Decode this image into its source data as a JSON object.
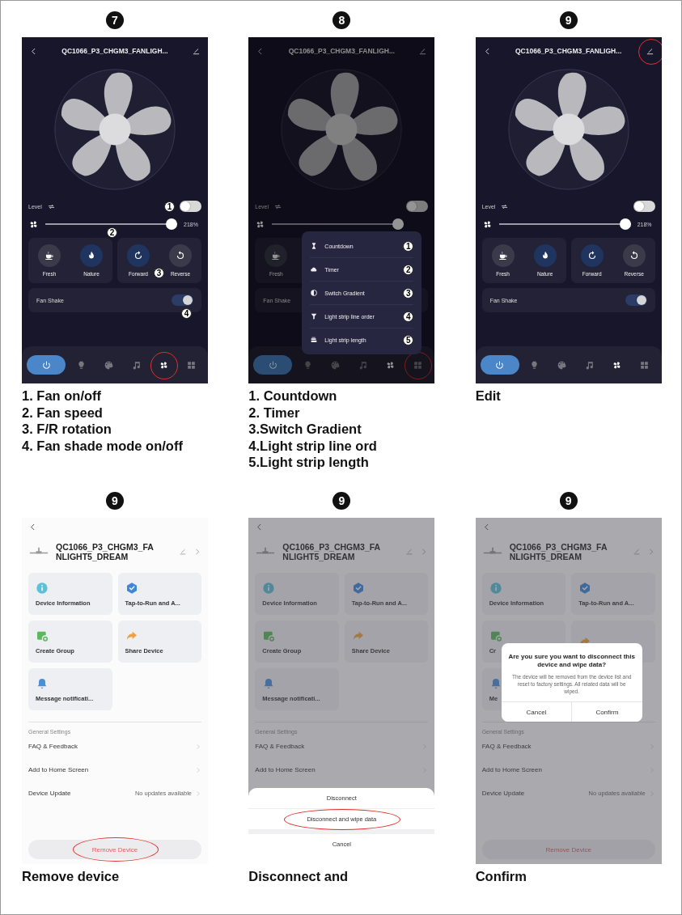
{
  "panels": [
    {
      "step": "7",
      "screen": {
        "kind": "control",
        "title": "QC1066_P3_CHGM3_FANLIGH...",
        "edit_circled": false,
        "level_label": "Level",
        "light_on": false,
        "light_callout": "1",
        "speed": {
          "level": 1,
          "reading": "218%",
          "callout": "2"
        },
        "modes": [
          {
            "kind": "fresh",
            "label": "Fresh",
            "selected": false
          },
          {
            "kind": "nature",
            "label": "Nature",
            "selected": true
          }
        ],
        "directions": [
          {
            "kind": "forward",
            "label": "Forward",
            "selected": true
          },
          {
            "kind": "reverse",
            "label": "Reverse",
            "selected": false
          }
        ],
        "direction_callout": "3",
        "shake": {
          "label": "Fan Shake",
          "on": true,
          "callout": "4"
        },
        "power_on": true,
        "tabs": [
          {
            "kind": "bulb",
            "selected": false,
            "circled": false
          },
          {
            "kind": "palette",
            "selected": false,
            "circled": false
          },
          {
            "kind": "music",
            "selected": false,
            "circled": false
          },
          {
            "kind": "fan",
            "selected": true,
            "circled": true
          },
          {
            "kind": "grid",
            "selected": false,
            "circled": false
          }
        ]
      },
      "caption": [
        "1. Fan on/off",
        "2. Fan speed",
        "3. F/R rotation",
        "4. Fan shade mode on/off"
      ]
    },
    {
      "step": "8",
      "screen": {
        "kind": "control",
        "dimmed": true,
        "title": "QC1066_P3_CHGM3_FANLIGH...",
        "edit_circled": false,
        "level_label": "Level",
        "light_on": false,
        "speed": {
          "level": 1
        },
        "modes": [
          {
            "kind": "fresh",
            "label": "Fresh",
            "selected": false
          }
        ],
        "shake": {
          "label": "Fan Shake"
        },
        "power_on": true,
        "tabs": [
          {
            "kind": "bulb",
            "selected": false,
            "circled": false
          },
          {
            "kind": "palette",
            "selected": false,
            "circled": false
          },
          {
            "kind": "music",
            "selected": false,
            "circled": false
          },
          {
            "kind": "fan",
            "selected": true,
            "circled": false
          },
          {
            "kind": "grid",
            "selected": false,
            "circled": true
          }
        ],
        "menu": [
          {
            "kind": "countdown",
            "label": "Countdown",
            "callout": "1"
          },
          {
            "kind": "timer",
            "label": "Timer",
            "callout": "2"
          },
          {
            "kind": "gradient",
            "label": "Switch Gradient",
            "callout": "3"
          },
          {
            "kind": "order",
            "label": "Light strip line order",
            "callout": "4"
          },
          {
            "kind": "length",
            "label": "Light strip length",
            "callout": "5"
          }
        ]
      },
      "caption": [
        "1. Countdown",
        "2. Timer",
        "3.Switch Gradient",
        "4.Light strip line ord",
        "5.Light strip length"
      ]
    },
    {
      "step": "9",
      "screen": {
        "kind": "control",
        "title": "QC1066_P3_CHGM3_FANLIGH...",
        "edit_circled": true,
        "level_label": "Level",
        "light_on": false,
        "speed": {
          "level": 1,
          "reading": "218%"
        },
        "modes": [
          {
            "kind": "fresh",
            "label": "Fresh",
            "selected": false
          },
          {
            "kind": "nature",
            "label": "Nature",
            "selected": true
          }
        ],
        "directions": [
          {
            "kind": "forward",
            "label": "Forward",
            "selected": true
          },
          {
            "kind": "reverse",
            "label": "Reverse",
            "selected": false
          }
        ],
        "shake": {
          "label": "Fan Shake",
          "on": true
        },
        "power_on": true,
        "tabs": [
          {
            "kind": "bulb",
            "selected": false,
            "circled": false
          },
          {
            "kind": "palette",
            "selected": false,
            "circled": false
          },
          {
            "kind": "music",
            "selected": false,
            "circled": false
          },
          {
            "kind": "fan",
            "selected": true,
            "circled": false
          },
          {
            "kind": "grid",
            "selected": false,
            "circled": false
          }
        ]
      },
      "caption": [
        "Edit"
      ]
    },
    {
      "step": "9",
      "screen": {
        "kind": "settings",
        "title_lines": [
          "QC1066_P3_CHGM3_FA",
          "NLIGHT5_DREAM"
        ],
        "tiles": [
          {
            "kind": "info",
            "label": "Device Information"
          },
          {
            "kind": "automation",
            "label": "Tap-to-Run and A..."
          },
          {
            "kind": "group",
            "label": "Create Group"
          },
          {
            "kind": "share",
            "label": "Share Device"
          },
          {
            "kind": "bell",
            "label": "Message notificati..."
          }
        ],
        "section": "General Settings",
        "rows": [
          {
            "label": "FAQ & Feedback"
          },
          {
            "label": "Add to Home Screen"
          },
          {
            "label": "Device Update",
            "value": "No updates available"
          }
        ],
        "remove": {
          "label": "Remove Device",
          "circled": true
        }
      },
      "caption": [
        "Remove device"
      ]
    },
    {
      "step": "9",
      "screen": {
        "kind": "settings",
        "dimmed": true,
        "title_lines": [
          "QC1066_P3_CHGM3_FA",
          "NLIGHT5_DREAM"
        ],
        "tiles": [
          {
            "kind": "info",
            "label": "Device Information"
          },
          {
            "kind": "automation",
            "label": "Tap-to-Run and A..."
          },
          {
            "kind": "group",
            "label": "Create Group"
          },
          {
            "kind": "share",
            "label": "Share Device"
          },
          {
            "kind": "bell",
            "label": "Message notificati..."
          }
        ],
        "section": "General Settings",
        "rows": [
          {
            "label": "FAQ & Feedback"
          },
          {
            "label": "Add to Home Screen"
          }
        ],
        "sheet": {
          "options": [
            {
              "label": "Disconnect",
              "circled": false
            },
            {
              "label": "Disconnect and wipe data",
              "circled": true
            }
          ],
          "cancel": "Cancel"
        }
      },
      "caption": [
        "Disconnect and"
      ]
    },
    {
      "step": "9",
      "screen": {
        "kind": "settings",
        "dimmed": true,
        "title_lines": [
          "QC1066_P3_CHGM3_FA",
          "NLIGHT5_DREAM"
        ],
        "tiles": [
          {
            "kind": "info",
            "label": "Device Information"
          },
          {
            "kind": "automation",
            "label": "Tap-to-Run and A..."
          },
          {
            "kind": "group",
            "label": "Cr"
          },
          {
            "kind": "share"
          },
          {
            "kind": "bell",
            "label": "Me"
          }
        ],
        "section": "General Settings",
        "rows": [
          {
            "label": "FAQ & Feedback"
          },
          {
            "label": "Add to Home Screen"
          },
          {
            "label": "Device Update",
            "value": "No updates available"
          }
        ],
        "remove": {
          "label": "Remove Device",
          "circled": false
        },
        "dialog": {
          "title": "Are you sure you want to disconnect this device and wipe data?",
          "message": "The device will be removed from the device list and reset to factory settings. All related data will be wiped.",
          "buttons": [
            "Cancel",
            "Confirm"
          ]
        }
      },
      "caption": [
        "Confirm"
      ]
    }
  ]
}
